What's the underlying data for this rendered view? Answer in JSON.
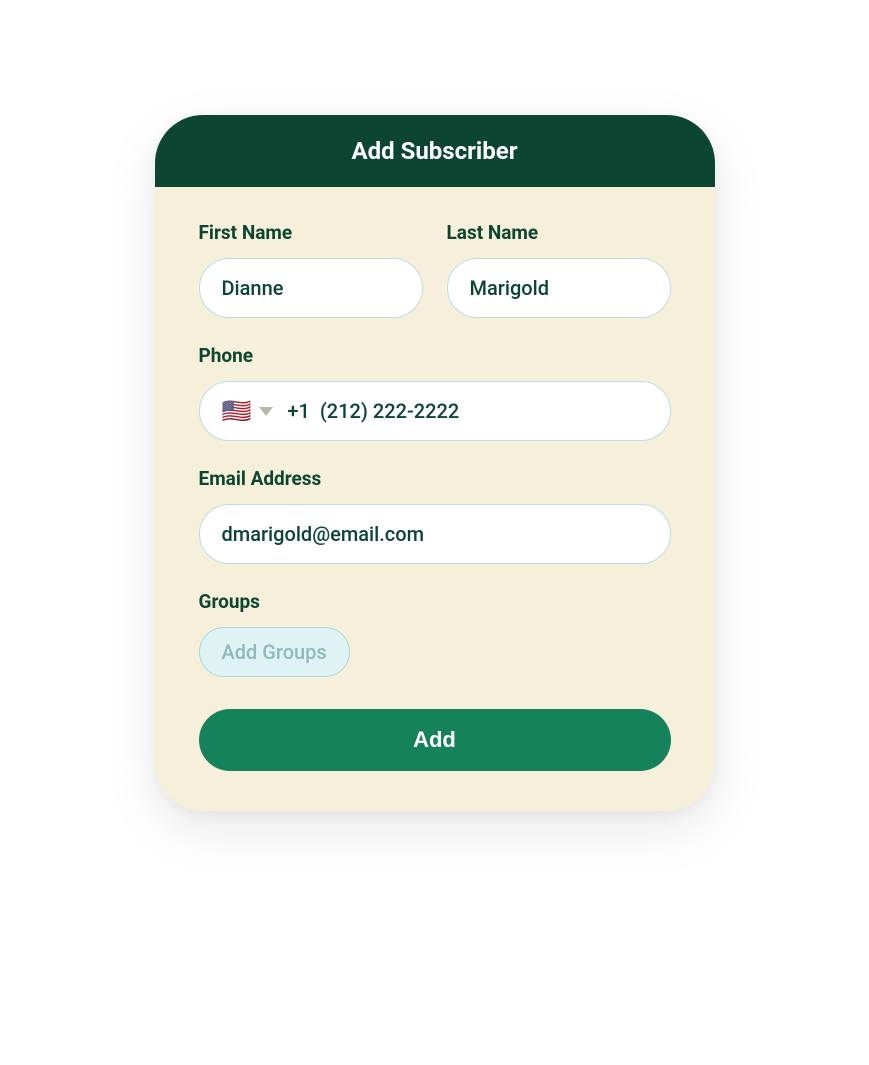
{
  "header": {
    "title": "Add Subscriber"
  },
  "form": {
    "first_name": {
      "label": "First Name",
      "value": "Dianne"
    },
    "last_name": {
      "label": "Last Name",
      "value": "Marigold"
    },
    "phone": {
      "label": "Phone",
      "flag": "🇺🇸",
      "country_code": "+1",
      "value": "(212) 222-2222"
    },
    "email": {
      "label": "Email Address",
      "value": "dmarigold@email.com"
    },
    "groups": {
      "label": "Groups",
      "chip_placeholder": "Add Groups"
    },
    "submit_label": "Add"
  }
}
